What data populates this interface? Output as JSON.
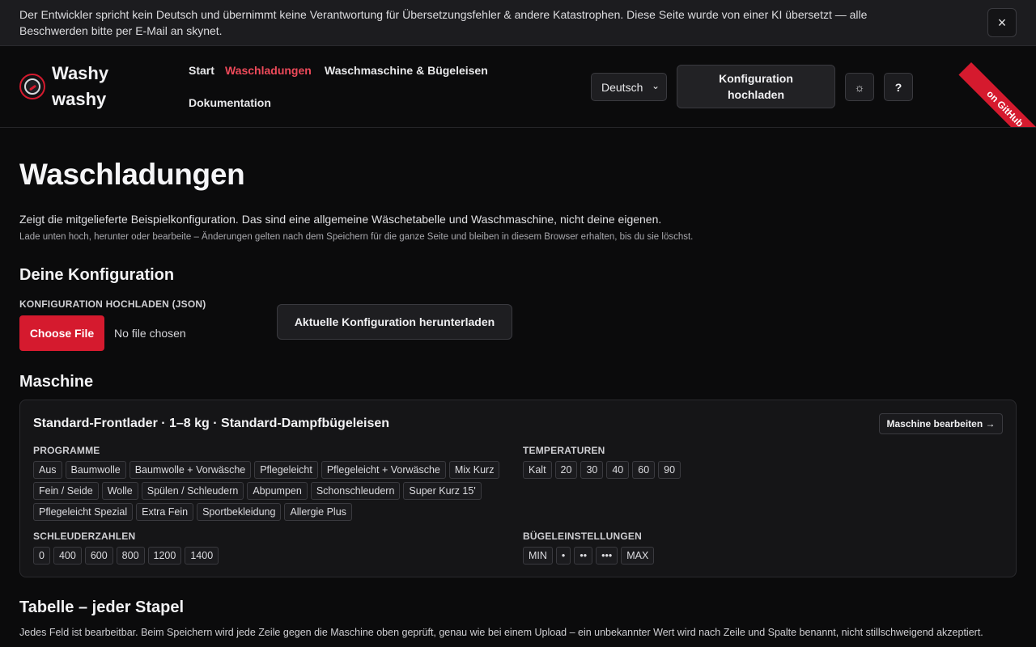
{
  "banner": {
    "text": "Der Entwickler spricht kein Deutsch und übernimmt keine Verantwortung für Übersetzungsfehler & andere Katastrophen. Diese Seite wurde von einer KI übersetzt — alle Beschwerden bitte per E-Mail an skynet.",
    "close_icon": "×"
  },
  "header": {
    "brand": "Washy washy",
    "nav": {
      "start": "Start",
      "loads": "Waschladungen",
      "machine": "Waschmaschine & Bügeleisen",
      "docs": "Dokumentation"
    },
    "language": "Deutsch",
    "upload_label": "Konfiguration hochladen",
    "theme_icon": "☼",
    "help_label": "?",
    "github_ribbon": "on GitHub"
  },
  "main": {
    "title": "Waschladungen",
    "intro": "Zeigt die mitgelieferte Beispielkonfiguration. Das sind eine allgemeine Wäschetabelle und Waschmaschine, nicht deine eigenen.",
    "intro_sub": "Lade unten hoch, herunter oder bearbeite – Änderungen gelten nach dem Speichern für die ganze Seite und bleiben in diesem Browser erhalten, bis du sie löschst.",
    "config_heading": "Deine Konfiguration",
    "upload_json_label": "KONFIGURATION HOCHLADEN (JSON)",
    "choose_file": "Choose File",
    "no_file": "No file chosen",
    "download_label": "Aktuelle Konfiguration herunterladen",
    "machine_heading": "Maschine"
  },
  "machine": {
    "title": "Standard-Frontlader · 1–8 kg · Standard-Dampfbügeleisen",
    "edit_label": "Maschine bearbeiten →",
    "programs_label": "PROGRAMME",
    "programs": [
      "Aus",
      "Baumwolle",
      "Baumwolle + Vorwäsche",
      "Pflegeleicht",
      "Pflegeleicht + Vorwäsche",
      "Mix Kurz",
      "Fein / Seide",
      "Wolle",
      "Spülen / Schleudern",
      "Abpumpen",
      "Schonschleudern",
      "Super Kurz 15'",
      "Pflegeleicht Spezial",
      "Extra Fein",
      "Sportbekleidung",
      "Allergie Plus"
    ],
    "temps_label": "TEMPERATUREN",
    "temps": [
      "Kalt",
      "20",
      "30",
      "40",
      "60",
      "90"
    ],
    "spins_label": "SCHLEUDERZAHLEN",
    "spins": [
      "0",
      "400",
      "600",
      "800",
      "1200",
      "1400"
    ],
    "iron_label": "BÜGELEINSTELLUNGEN",
    "iron": [
      "MIN",
      "•",
      "••",
      "•••",
      "MAX"
    ]
  },
  "table": {
    "heading": "Tabelle – jeder Stapel",
    "desc": "Jedes Feld ist bearbeitbar. Beim Speichern wird jede Zeile gegen die Maschine oben geprüft, genau wie bei einem Upload – ein unbekannter Wert wird nach Zeile und Spalte benannt, nicht stillschweigend akzeptiert."
  }
}
